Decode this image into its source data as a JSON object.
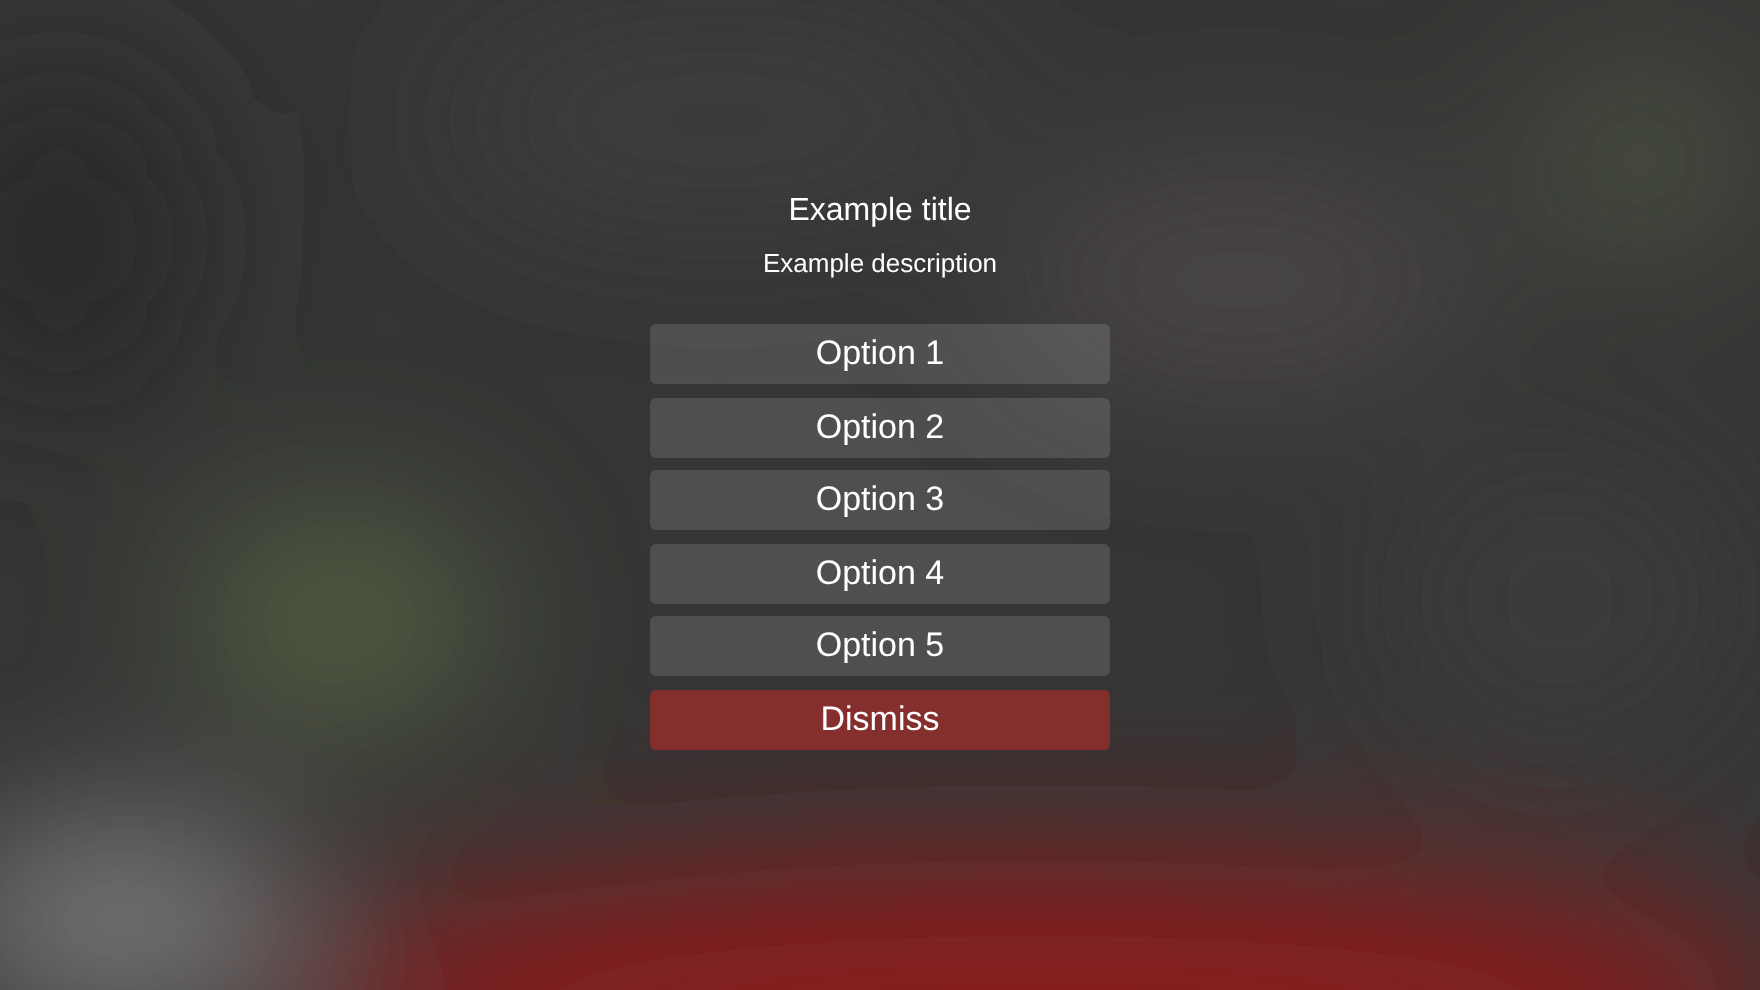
{
  "alert": {
    "title": "Example title",
    "description": "Example description",
    "actions": [
      {
        "label": "Option 1",
        "kind": "default"
      },
      {
        "label": "Option 2",
        "kind": "default"
      },
      {
        "label": "Option 3",
        "kind": "default"
      },
      {
        "label": "Option 4",
        "kind": "default"
      },
      {
        "label": "Option 5",
        "kind": "default"
      },
      {
        "label": "Dismiss",
        "kind": "destructive"
      }
    ]
  }
}
